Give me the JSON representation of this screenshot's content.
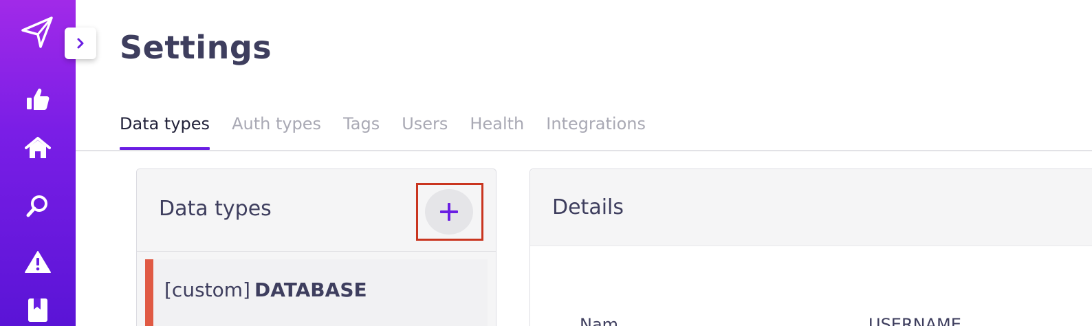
{
  "page": {
    "title": "Settings"
  },
  "sidebar": {
    "toggle_icon": "chevron-right-icon",
    "items": [
      {
        "icon": "paper-plane-logo-icon"
      },
      {
        "icon": "thumbs-up-icon"
      },
      {
        "icon": "home-icon"
      },
      {
        "icon": "search-icon"
      },
      {
        "icon": "warning-icon"
      },
      {
        "icon": "bookmark-icon"
      }
    ]
  },
  "tabs": [
    {
      "label": "Data types",
      "active": true
    },
    {
      "label": "Auth types",
      "active": false
    },
    {
      "label": "Tags",
      "active": false
    },
    {
      "label": "Users",
      "active": false
    },
    {
      "label": "Health",
      "active": false
    },
    {
      "label": "Integrations",
      "active": false
    }
  ],
  "data_types_panel": {
    "title": "Data types",
    "add_icon": "plus-icon",
    "items": [
      {
        "prefix": "[custom]",
        "name": "DATABASE"
      }
    ]
  },
  "details_panel": {
    "title": "Details",
    "row": {
      "label": "Nam",
      "value": "USERNAME"
    }
  },
  "colors": {
    "accent": "#6a1ee3",
    "sidebar_top": "#a12ae8",
    "sidebar_bottom": "#5a14d6",
    "item_marker": "#e05a44",
    "highlight_box": "#c9351f"
  }
}
